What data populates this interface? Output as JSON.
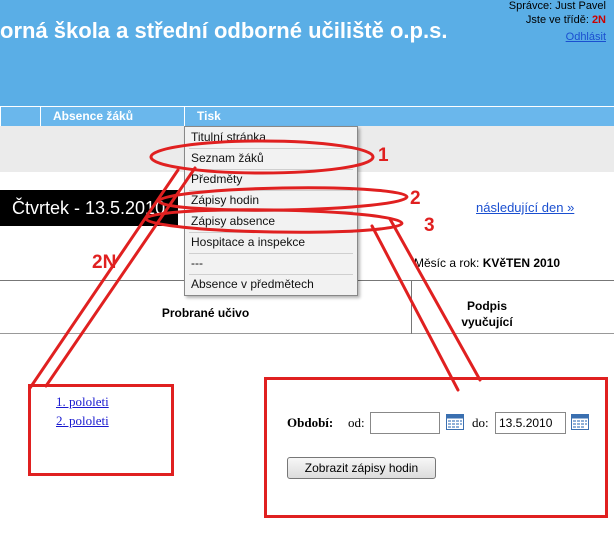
{
  "header": {
    "school_title": "orná škola a střední odborné učiliště o.p.s.",
    "admin": "Správce: Just Pavel",
    "class_prefix": "Jste ve třídě: ",
    "class_value": "2N",
    "logout": "Odhlásit"
  },
  "nav": {
    "absence": "Absence žáků",
    "tisk": "Tisk"
  },
  "menu": {
    "items": [
      "Titulní stránka",
      "Seznam žáků",
      "Předměty",
      "Zápisy hodin",
      "Zápisy absence",
      "Hospitace a inspekce",
      "---",
      "Absence v předmětech"
    ]
  },
  "day": {
    "label": "Čtvrtek - 13.5.2010",
    "next": "následující den »",
    "month_prefix": "Měsíc a rok: ",
    "month_value": "KVěTEN 2010"
  },
  "table": {
    "col_probrane": "Probrané učivo",
    "col_podpis_1": "Podpis",
    "col_podpis_2": "vyučující"
  },
  "pololeti": {
    "first": "1. pololeti",
    "second": "2. pololeti"
  },
  "period_form": {
    "label": "Období:",
    "od": "od:",
    "od_value": "",
    "do": "do:",
    "do_value": "13.5.2010",
    "button": "Zobrazit zápisy hodin"
  },
  "annotations": {
    "one": "1",
    "two": "2",
    "three": "3",
    "class_2n": "2N"
  },
  "colors": {
    "header_blue": "#5aaee6",
    "annotation_red": "#e02020",
    "link_blue": "#1a4fd0"
  }
}
